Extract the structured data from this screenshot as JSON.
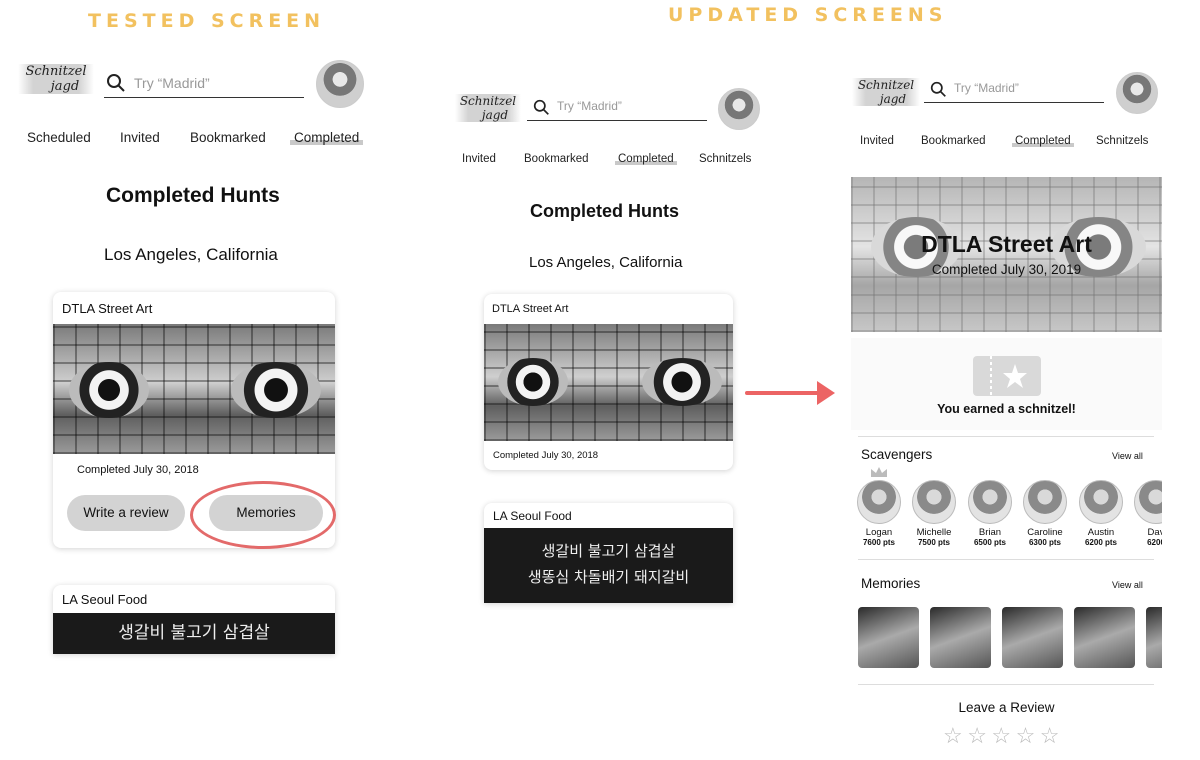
{
  "headings": {
    "tested": "TESTED SCREEN",
    "updated": "UPDATED SCREENS"
  },
  "logo": {
    "line1": "Schnitzel",
    "line2": "jagd"
  },
  "search": {
    "placeholder": "Try “Madrid”"
  },
  "screen1": {
    "tabs": [
      "Scheduled",
      "Invited",
      "Bookmarked",
      "Completed"
    ],
    "selected_tab": "Completed",
    "title": "Completed Hunts",
    "location": "Los Angeles, California",
    "card1": {
      "name": "DTLA Street Art",
      "date": "Completed July 30, 2018",
      "review_btn": "Write a review",
      "memories_btn": "Memories"
    },
    "card2": {
      "name": "LA Seoul Food",
      "neon1": "생갈비  불고기  삼겹살"
    }
  },
  "screen2": {
    "tabs": [
      "Invited",
      "Bookmarked",
      "Completed",
      "Schnitzels"
    ],
    "selected_tab": "Completed",
    "title": "Completed Hunts",
    "location": "Los Angeles, California",
    "card1": {
      "name": "DTLA Street Art",
      "date": "Completed July 30, 2018"
    },
    "card2": {
      "name": "LA Seoul Food",
      "neon1": "생갈비  불고기  삼겹살",
      "neon2": "생똥심  차돌배기  돼지갈비"
    }
  },
  "screen3": {
    "tabs": [
      "Invited",
      "Bookmarked",
      "Completed",
      "Schnitzels"
    ],
    "selected_tab": "Completed",
    "hero_title": "DTLA Street Art",
    "hero_date": "Completed July 30, 2019",
    "earned": "You earned a schnitzel!",
    "scavengers_title": "Scavengers",
    "view_all": "View all",
    "scavengers": [
      {
        "name": "Logan",
        "points": "7600 pts"
      },
      {
        "name": "Michelle",
        "points": "7500 pts"
      },
      {
        "name": "Brian",
        "points": "6500 pts"
      },
      {
        "name": "Caroline",
        "points": "6300 pts"
      },
      {
        "name": "Austin",
        "points": "6200 pts"
      },
      {
        "name": "Dav",
        "points": "6200"
      }
    ],
    "memories_title": "Memories",
    "review_title": "Leave a Review",
    "stars": [
      "☆",
      "☆",
      "☆",
      "☆",
      "☆"
    ]
  },
  "colors": {
    "heading": "#f2c15f",
    "arrow": "#ec6464",
    "highlight_ring": "#e36a6a",
    "pill": "#d3d3d3"
  },
  "icons": [
    "search-icon",
    "star-icon",
    "crown-icon",
    "arrow-right-icon",
    "ticket-icon"
  ]
}
